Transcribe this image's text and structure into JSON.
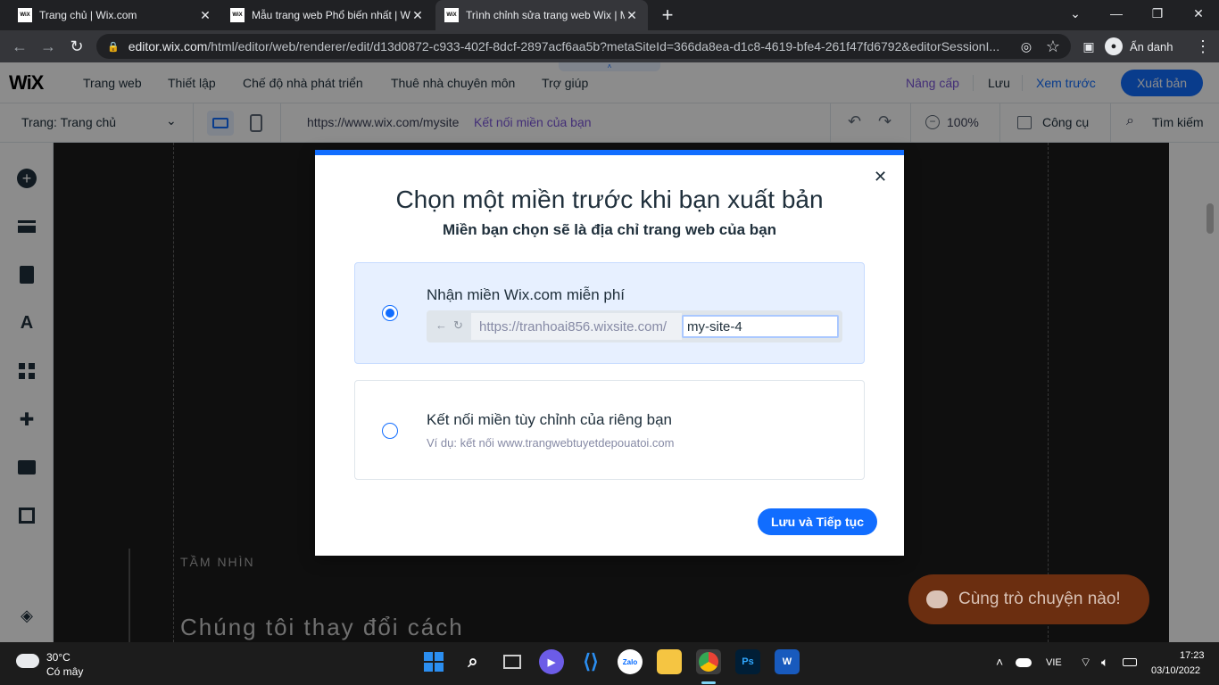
{
  "browser": {
    "tabs": [
      {
        "title": "Trang chủ | Wix.com",
        "favicon": "WiX"
      },
      {
        "title": "Mẫu trang web Phổ biến nhất | W",
        "favicon": "WiX"
      },
      {
        "title": "Trình chỉnh sửa trang web Wix | M",
        "favicon": "WiX"
      }
    ],
    "new_tab": "+",
    "url_host": "editor.wix.com",
    "url_path": "/html/editor/web/renderer/edit/d13d0872-c933-402f-8dcf-2897acf6aa5b?metaSiteId=366da8ea-d1c8-4619-bfe4-261f47fd6792&editorSessionI...",
    "profile_label": "Ẩn danh"
  },
  "wix_top": {
    "logo": "WiX",
    "menu": [
      "Trang web",
      "Thiết lập",
      "Chế độ nhà phát triển",
      "Thuê nhà chuyên môn",
      "Trợ giúp"
    ],
    "upgrade": "Nâng cấp",
    "save": "Lưu",
    "preview": "Xem trước",
    "publish": "Xuất bản"
  },
  "wix_second": {
    "page_label": "Trang: Trang chủ",
    "site_url": "https://www.wix.com/mysite",
    "connect_domain": "Kết nối miền của bạn",
    "zoom": "100%",
    "tools": "Công cụ",
    "search": "Tìm kiếm"
  },
  "canvas": {
    "vision_label": "TẦM NHÌN",
    "heading": "Chúng tôi thay đổi cách",
    "chat_label": "Cùng trò chuyện nào!"
  },
  "modal": {
    "title": "Chọn một miền trước khi bạn xuất bản",
    "subtitle": "Miền bạn chọn sẽ là địa chỉ trang web của bạn",
    "option1": {
      "label": "Nhận miền Wix.com miễn phí",
      "prefix": "https://tranhoai856.wixsite.com/",
      "value": "my-site-4",
      "selected": true
    },
    "option2": {
      "label": "Kết nối miền tùy chỉnh của riêng bạn",
      "hint": "Ví dụ: kết nối www.trangwebtuyetdepouatoi.com",
      "selected": false
    },
    "save_continue": "Lưu và Tiếp tục"
  },
  "taskbar": {
    "weather_temp": "30°C",
    "weather_desc": "Có mây",
    "lang": "VIE",
    "time": "17:23",
    "date": "03/10/2022"
  },
  "colors": {
    "accent": "#116dff",
    "wix_text": "#20303c",
    "chat_bubble": "#c2521b"
  }
}
